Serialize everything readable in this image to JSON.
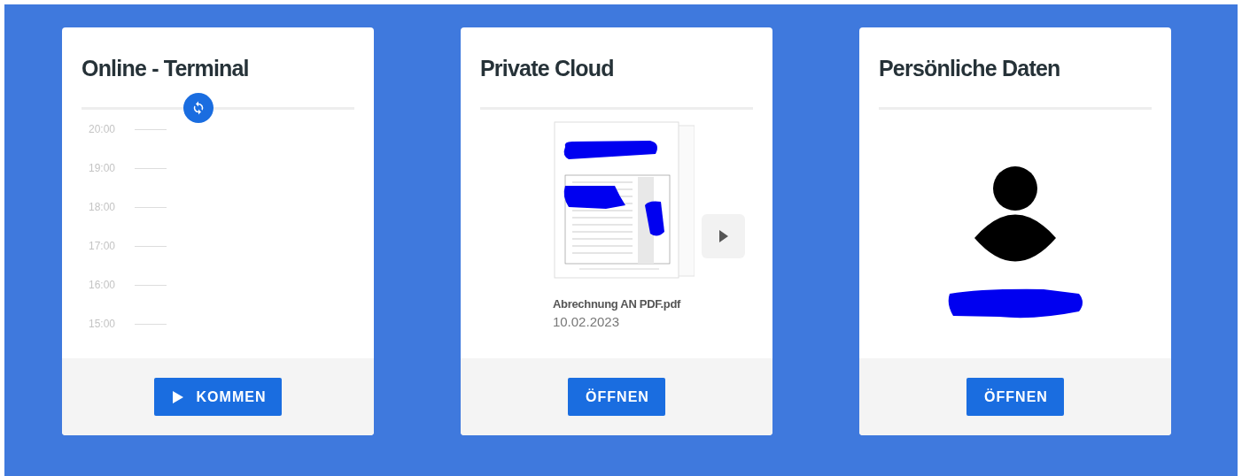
{
  "cards": [
    {
      "kind": "terminal",
      "title": "Online - Terminal",
      "times": [
        "20:00",
        "19:00",
        "18:00",
        "17:00",
        "16:00",
        "15:00"
      ],
      "button": {
        "label": "KOMMEN"
      }
    },
    {
      "kind": "cloud",
      "title": "Private Cloud",
      "file": {
        "name": "Abrechnung AN PDF.pdf",
        "date": "10.02.2023"
      },
      "button": {
        "label": "ÖFFNEN"
      }
    },
    {
      "kind": "profile",
      "title": "Persönliche Daten",
      "button": {
        "label": "ÖFFNEN"
      }
    }
  ]
}
